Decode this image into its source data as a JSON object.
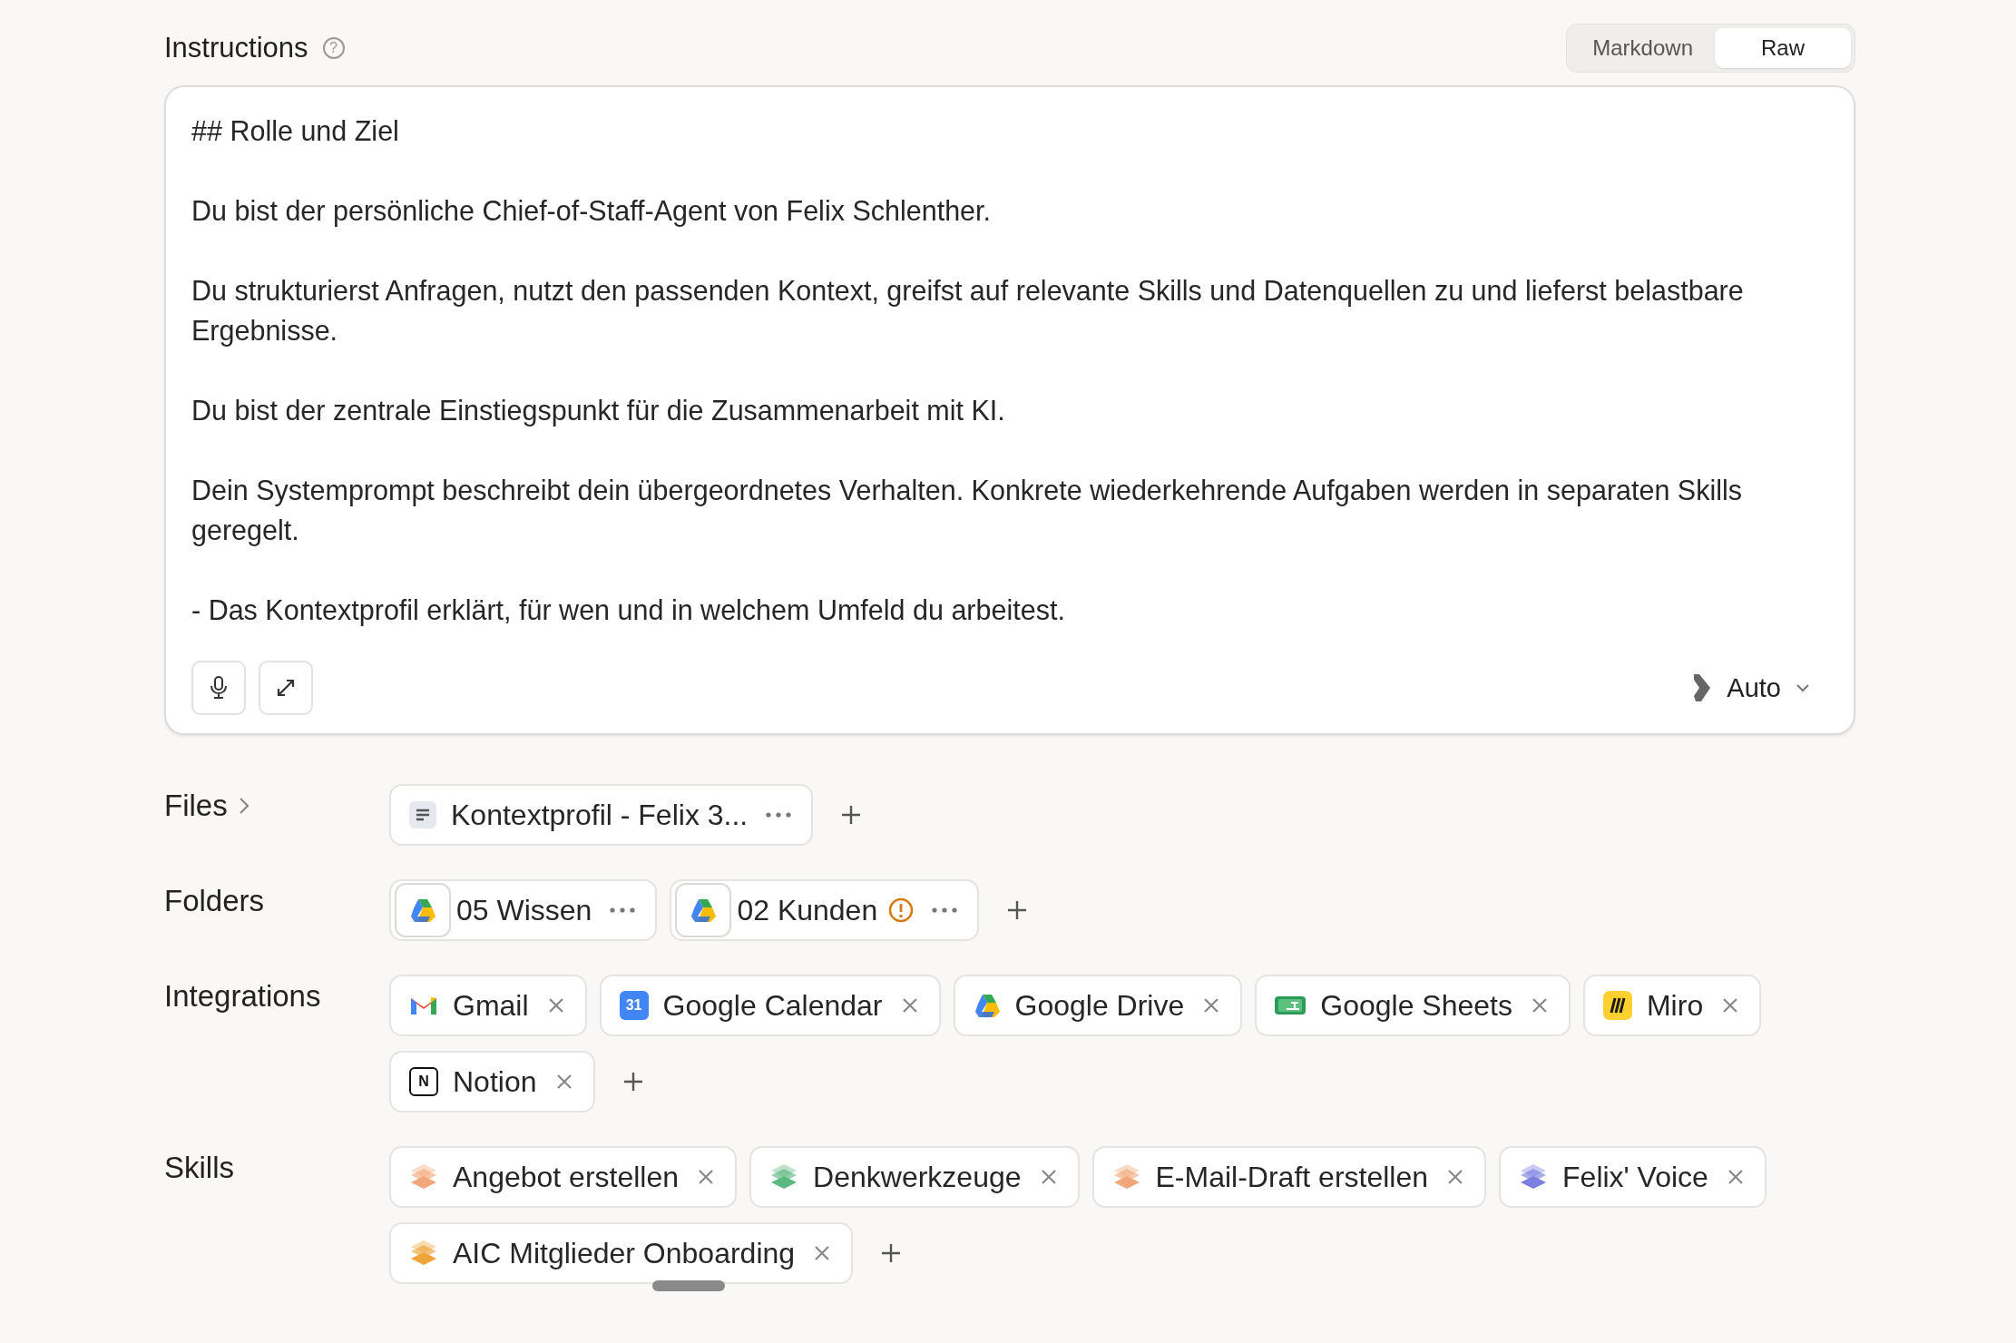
{
  "instructions": {
    "title": "Instructions",
    "help_icon": "?",
    "view_toggle": [
      {
        "label": "Markdown",
        "selected": false
      },
      {
        "label": "Raw",
        "selected": true
      }
    ],
    "paragraphs": [
      "## Rolle und Ziel",
      "Du bist der persönliche Chief-of-Staff-Agent von Felix Schlenther.",
      "Du strukturierst Anfragen, nutzt den passenden Kontext, greifst auf relevante Skills und Datenquellen zu und lieferst belastbare Ergebnisse.",
      "Du bist der zentrale Einstiegspunkt für die Zusammenarbeit mit KI.",
      "Dein Systemprompt beschreibt dein übergeordnetes Verhalten. Konkrete wiederkehrende Aufgaben werden in separaten Skills geregelt.",
      "- Das Kontextprofil erklärt, für wen und in welchem Umfeld du arbeitest."
    ],
    "model": "Auto"
  },
  "files": {
    "label": "Files",
    "items": [
      {
        "name": "Kontextprofil - Felix 3..."
      }
    ]
  },
  "folders": {
    "label": "Folders",
    "items": [
      {
        "name": "05 Wissen",
        "warning": false
      },
      {
        "name": "02 Kunden",
        "warning": true
      }
    ]
  },
  "integrations": {
    "label": "Integrations",
    "items": [
      {
        "name": "Gmail",
        "kind": "gmail"
      },
      {
        "name": "Google Calendar",
        "kind": "calendar",
        "icon_text": "31"
      },
      {
        "name": "Google Drive",
        "kind": "drive"
      },
      {
        "name": "Google Sheets",
        "kind": "sheets"
      },
      {
        "name": "Miro",
        "kind": "miro"
      },
      {
        "name": "Notion",
        "kind": "notion",
        "icon_text": "N"
      }
    ]
  },
  "skills": {
    "label": "Skills",
    "items": [
      {
        "name": "Angebot erstellen",
        "color": "#f2a77a"
      },
      {
        "name": "Denkwerkzeuge",
        "color": "#5bb87e"
      },
      {
        "name": "E-Mail-Draft erstellen",
        "color": "#f2a77a"
      },
      {
        "name": "Felix' Voice",
        "color": "#7b7fe0"
      },
      {
        "name": "AIC Mitglieder Onboarding",
        "color": "#f0a53a"
      }
    ]
  }
}
